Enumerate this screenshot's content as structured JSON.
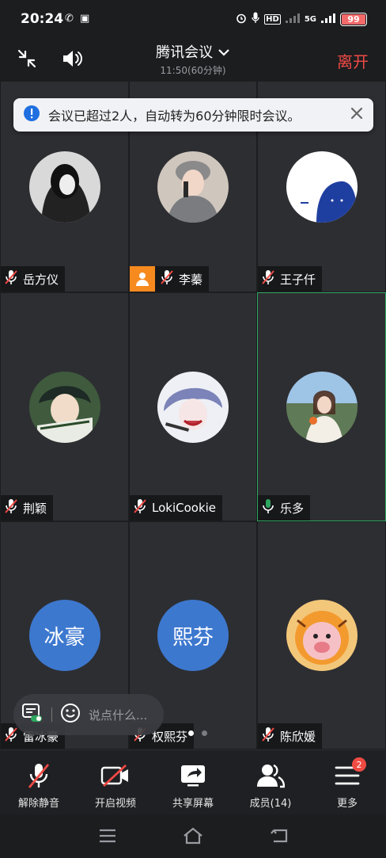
{
  "status": {
    "time": "20:24",
    "app_icons": "✆ ▣",
    "net": "5G",
    "battery": "99"
  },
  "header": {
    "title": "腾讯会议",
    "subtitle": "11:50(60分钟)",
    "leave": "离开"
  },
  "toast": {
    "text": "会议已超过2人，自动转为60分钟限时会议。"
  },
  "participants": [
    {
      "name": "岳方仪",
      "muted": true,
      "avatar": "photo"
    },
    {
      "name": "李蓁",
      "muted": true,
      "avatar": "photo",
      "host": true
    },
    {
      "name": "王子仟",
      "muted": true,
      "avatar": "photo"
    },
    {
      "name": "荆颖",
      "muted": true,
      "avatar": "photo"
    },
    {
      "name": "LokiCookie",
      "muted": true,
      "avatar": "photo"
    },
    {
      "name": "乐多",
      "muted": false,
      "avatar": "photo",
      "speaking": true
    },
    {
      "name": "雷冰豪",
      "muted": true,
      "avatar_text": "冰豪"
    },
    {
      "name": "权熙芬",
      "muted": true,
      "avatar_text": "熙芬"
    },
    {
      "name": "陈欣媛",
      "muted": true,
      "avatar": "photo"
    }
  ],
  "chat": {
    "placeholder": "说点什么..."
  },
  "toolbar": {
    "unmute": "解除静音",
    "video": "开启视频",
    "share": "共享屏幕",
    "members": "成员(14)",
    "more": "更多",
    "more_badge": "2"
  },
  "colors": {
    "accent_red": "#f04a45",
    "speaking_green": "#2ea860",
    "avatar_blue": "#3d78cf",
    "host_orange": "#f68a1e"
  }
}
